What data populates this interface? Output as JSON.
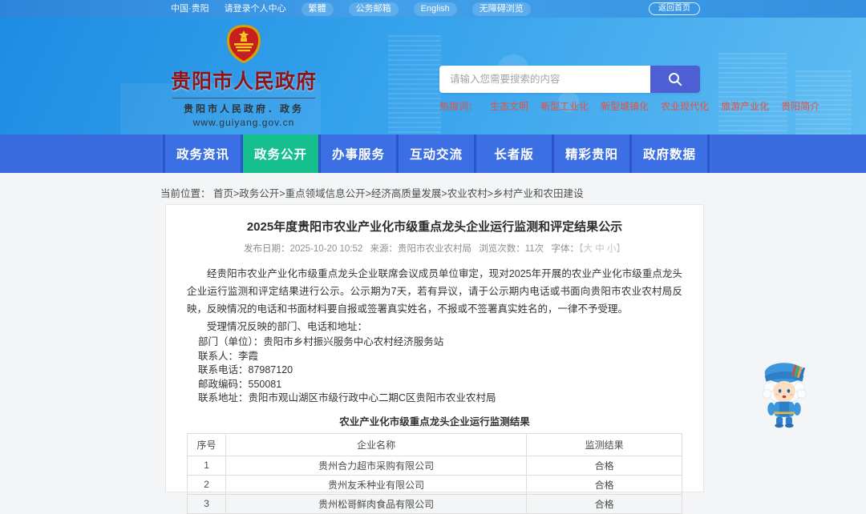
{
  "topbar": {
    "links": [
      "中国·贵阳",
      "请登录个人中心",
      "繁體",
      "公务邮箱",
      "English",
      "无障碍浏览"
    ],
    "home_button": "返回首页"
  },
  "header": {
    "site_name": "贵阳市人民政府",
    "site_subtitle": "贵阳市人民政府．政务",
    "site_url": "www.guiyang.gov.cn",
    "search": {
      "placeholder": "请输入您需要搜索的内容"
    },
    "hot_search": {
      "label": "热搜词：",
      "terms": [
        "生态文明",
        "新型工业化",
        "新型城镇化",
        "农业现代化",
        "旅游产业化",
        "贵阳简介"
      ]
    }
  },
  "nav": {
    "items": [
      {
        "label": "政务资讯",
        "active": false
      },
      {
        "label": "政务公开",
        "active": true
      },
      {
        "label": "办事服务",
        "active": false
      },
      {
        "label": "互动交流",
        "active": false
      },
      {
        "label": "长者版",
        "active": false
      },
      {
        "label": "精彩贵阳",
        "active": false
      },
      {
        "label": "政府数据",
        "active": false
      }
    ]
  },
  "breadcrumb": {
    "label": "当前位置：",
    "path": "首页>政务公开>重点领域信息公开>经济高质量发展>农业农村>乡村产业和农田建设"
  },
  "article": {
    "title": "2025年度贵阳市农业产业化市级重点龙头企业运行监测和评定结果公示",
    "meta": {
      "date": "发布日期：2025-10-20 10:52",
      "source": "来源：贵阳市农业农村局",
      "views": "浏览次数：11次",
      "font_label": "字体：",
      "font_sizes": "【大 中 小】"
    },
    "intro": "经贵阳市农业产业化市级重点龙头企业联席会议成员单位审定，现对2025年开展的农业产业化市级重点龙头企业运行监测和评定结果进行公示。公示期为7天，若有异议，请于公示期内电话或书面向贵阳市农业农村局反映，反映情况的电话和书面材料要自报或签署真实姓名，不报或不签署真实姓名的，一律不予受理。",
    "reply_heading": "受理情况反映的部门、电话和地址：",
    "contact_lines": [
      "部门（单位）：贵阳市乡村振兴服务中心农村经济服务站",
      "联系人：李霞",
      "联系电话：87987120",
      "邮政编码：550081",
      "联系地址：贵阳市观山湖区市级行政中心二期C区贵阳市农业农村局"
    ],
    "table": {
      "caption": "农业产业化市级重点龙头企业运行监测结果",
      "headers": [
        "序号",
        "企业名称",
        "监测结果"
      ],
      "rows": [
        [
          "1",
          "贵州合力超市采购有限公司",
          "合格"
        ],
        [
          "2",
          "贵州友禾种业有限公司",
          "合格"
        ],
        [
          "3",
          "贵州松哥鲜肉食品有限公司",
          "合格"
        ]
      ]
    }
  },
  "icons": {
    "search": "magnifier-icon",
    "emblem": "china-national-emblem",
    "mascot": "blue-costume-mascot"
  },
  "colors": {
    "topbar_blue": "#3793e2",
    "banner_blue": "#35a2ec",
    "nav_blue": "#3c6fe4",
    "nav_active_green": "#16c08e",
    "search_button_indigo": "#4e5fd3",
    "hot_search_red": "#e8503c",
    "logo_dark_red": "#8d151a"
  }
}
